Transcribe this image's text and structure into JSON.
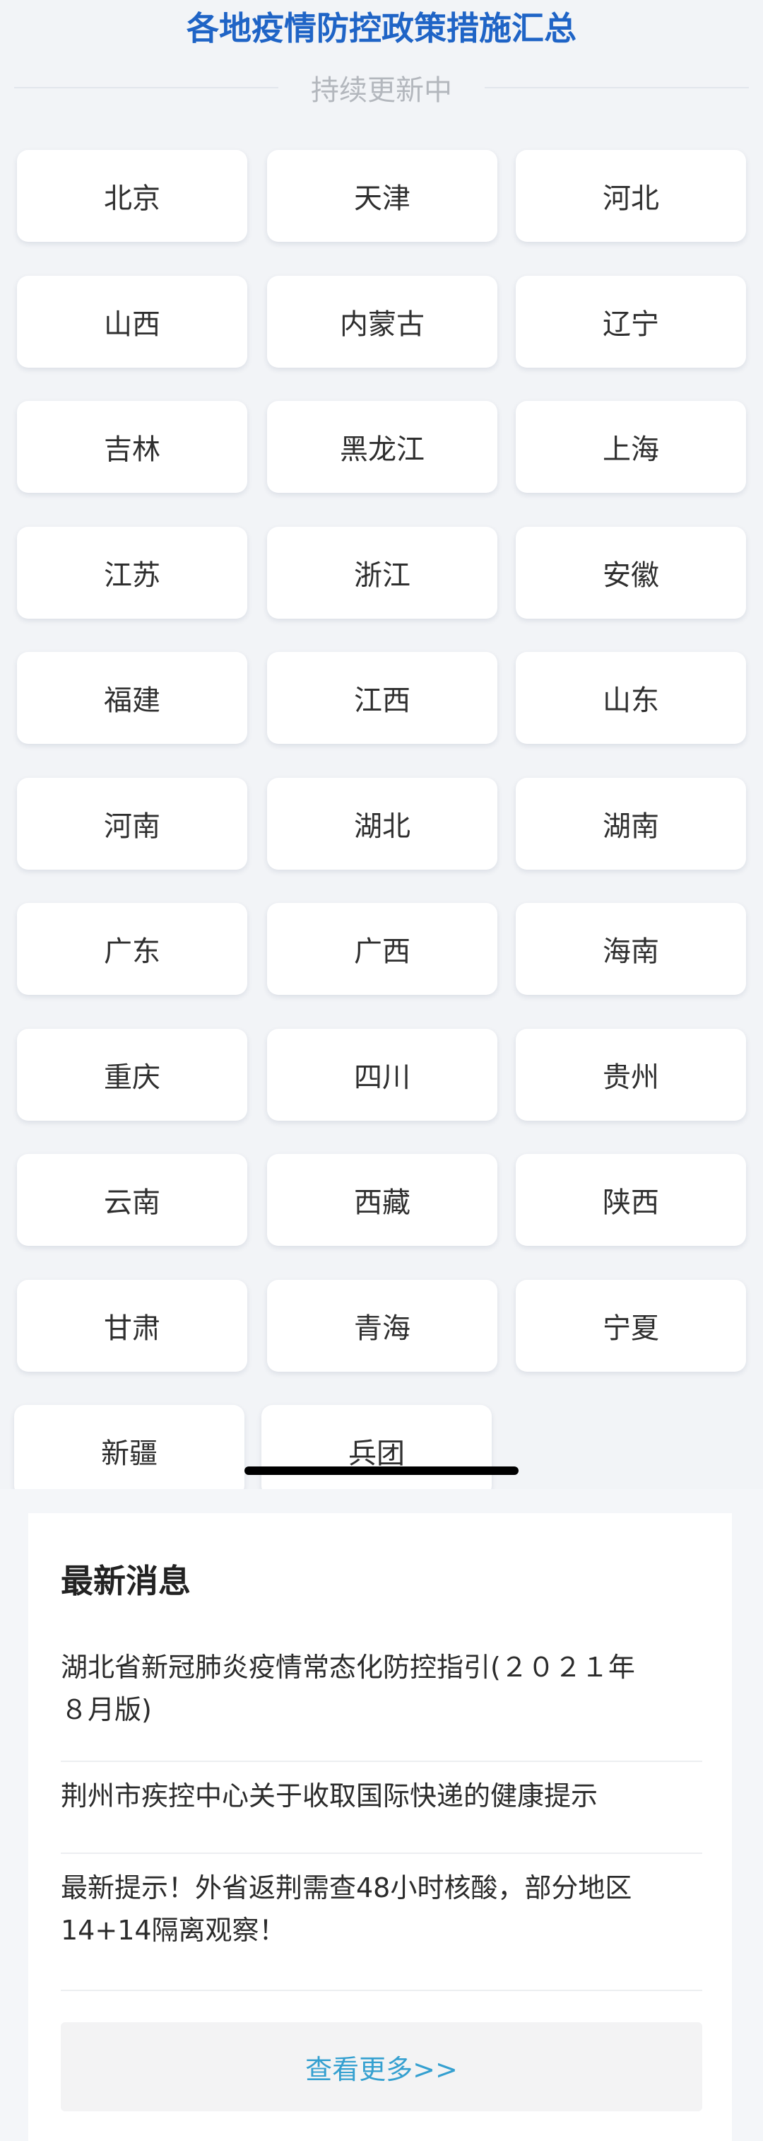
{
  "header": {
    "title": "各地疫情防控政策措施汇总",
    "subtitle": "持续更新中"
  },
  "regions": [
    "北京",
    "天津",
    "河北",
    "山西",
    "内蒙古",
    "辽宁",
    "吉林",
    "黑龙江",
    "上海",
    "江苏",
    "浙江",
    "安徽",
    "福建",
    "江西",
    "山东",
    "河南",
    "湖北",
    "湖南",
    "广东",
    "广西",
    "海南",
    "重庆",
    "四川",
    "贵州",
    "云南",
    "西藏",
    "陕西",
    "甘肃",
    "青海",
    "宁夏",
    "新疆",
    "兵团"
  ],
  "news": {
    "title": "最新消息",
    "items": [
      {
        "line1": "湖北省新冠肺炎疫情常态化防控指引(２０２１年",
        "line2": "８月版)"
      },
      {
        "line1": "荆州市疾控中心关于收取国际快递的健康提示",
        "line2": ""
      },
      {
        "line1": "最新提示！外省返荆需查48小时核酸，部分地区",
        "line2": "14+14隔离观察！"
      }
    ],
    "more_label": "查看更多>>"
  },
  "colors": {
    "title": "#1f64c6",
    "link": "#35a0d0",
    "background": "#f2f4f7"
  }
}
